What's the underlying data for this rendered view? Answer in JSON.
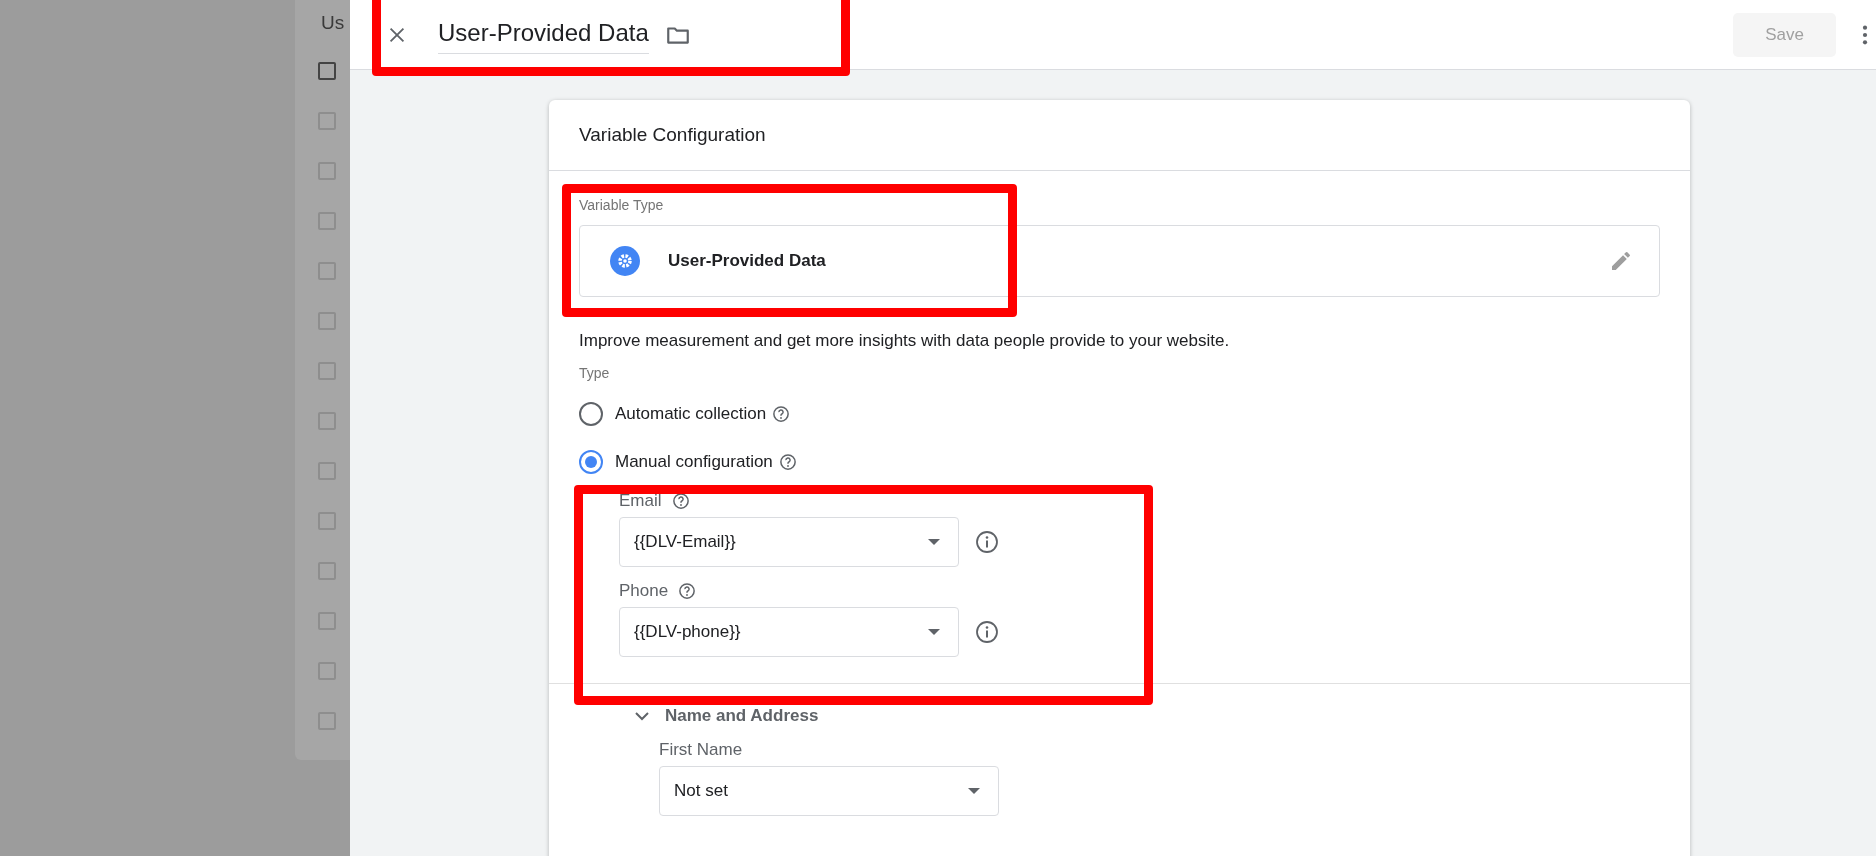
{
  "background_list": {
    "header_text": "Us",
    "header_checkbox": {
      "checked": false
    },
    "rows": [
      {
        "checked": false
      },
      {
        "checked": false
      },
      {
        "checked": false
      },
      {
        "checked": false
      },
      {
        "checked": false
      },
      {
        "checked": false
      },
      {
        "checked": false
      },
      {
        "checked": false
      },
      {
        "checked": false
      },
      {
        "checked": false
      },
      {
        "checked": false
      },
      {
        "checked": false
      },
      {
        "checked": false
      }
    ]
  },
  "header": {
    "title": "User-Provided Data",
    "save": {
      "label": "Save",
      "disabled": true
    }
  },
  "card": {
    "title": "Variable Configuration",
    "variable_type_label": "Variable Type",
    "variable_type": "User-Provided Data",
    "description": "Improve measurement and get more insights with data people provide to your website.",
    "type_label": "Type",
    "type_options": [
      {
        "label": "Automatic collection",
        "selected": false
      },
      {
        "label": "Manual configuration",
        "selected": true
      }
    ],
    "fields": [
      {
        "label": "Email",
        "value": "{{DLV-Email}}"
      },
      {
        "label": "Phone",
        "value": "{{DLV-phone}}"
      }
    ],
    "section": {
      "title": "Name and Address",
      "expanded": true,
      "fields": [
        {
          "label": "First Name",
          "value": "Not set"
        }
      ]
    }
  }
}
